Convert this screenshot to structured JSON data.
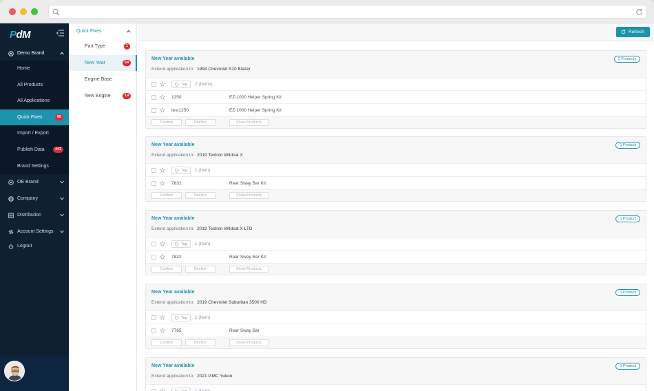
{
  "app": {
    "logo_p": "P",
    "logo_rest": "dM"
  },
  "sidebar": {
    "brand_label": "Demo Brand",
    "sub_items": [
      {
        "label": "Home",
        "badge": ""
      },
      {
        "label": "All Products",
        "badge": ""
      },
      {
        "label": "All Applications",
        "badge": ""
      },
      {
        "label": "Quick Fixes",
        "badge": "65",
        "active": true
      },
      {
        "label": "Import / Export",
        "badge": ""
      },
      {
        "label": "Publish Data",
        "badge": "443"
      },
      {
        "label": "Brand Settings",
        "badge": ""
      }
    ],
    "main_items": [
      {
        "label": "OE Brand",
        "icon": "circle-icon",
        "has_chevron": true
      },
      {
        "label": "Company",
        "icon": "globe-icon",
        "has_chevron": true
      },
      {
        "label": "Distribution",
        "icon": "grid-icon",
        "has_chevron": true
      },
      {
        "label": "Account Settings",
        "icon": "gear-icon",
        "has_chevron": true
      },
      {
        "label": "Logout",
        "icon": "power-icon",
        "has_chevron": false
      }
    ]
  },
  "quickfixes": {
    "header": "Quick Fixes",
    "items": [
      {
        "label": "Part Type",
        "badge": "1"
      },
      {
        "label": "New Year",
        "badge": "64",
        "active": true
      },
      {
        "label": "Engine Base",
        "badge": ""
      },
      {
        "label": "New Engine",
        "badge": "19"
      }
    ]
  },
  "toolbar": {
    "refresh_label": "Refresh"
  },
  "labels": {
    "extend_prefix": "Extend application to:",
    "tag": "Tag",
    "confirm": "Confirm",
    "decline": "Decline",
    "show_products": "Show Products"
  },
  "cards": [
    {
      "title": "New Year available",
      "vehicle": "1994 Chevrolet S10 Blazer",
      "count_pill": "2 Products",
      "items_count": "2 (Items)",
      "rows": [
        {
          "part": "1250",
          "desc": "EZ-1000 Helper Spring Kit"
        },
        {
          "part": "test1250",
          "desc": "EZ-1000 Helper Spring Kit"
        }
      ]
    },
    {
      "title": "New Year available",
      "vehicle": "2019 Textron Wildcat X",
      "count_pill": "1 Product",
      "items_count": "1 (Item)",
      "rows": [
        {
          "part": "7832",
          "desc": "Rear Sway Bar Kit"
        }
      ]
    },
    {
      "title": "New Year available",
      "vehicle": "2019 Textron Wildcat X LTD",
      "count_pill": "1 Product",
      "items_count": "1 (Item)",
      "rows": [
        {
          "part": "7832",
          "desc": "Rear Sway Bar Kit"
        }
      ]
    },
    {
      "title": "New Year available",
      "vehicle": "2019 Chevrolet Suburban 3500 HD",
      "count_pill": "1 Product",
      "items_count": "1 (Item)",
      "rows": [
        {
          "part": "7765",
          "desc": "Rear Sway Bar"
        }
      ]
    },
    {
      "title": "New Year available",
      "vehicle": "2021 GMC Yukon",
      "count_pill": "1 Product",
      "items_count": "1 (Item)",
      "rows": []
    }
  ]
}
